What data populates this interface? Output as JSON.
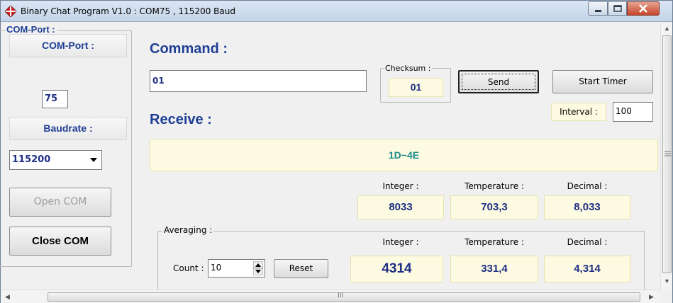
{
  "window": {
    "title": "Binary Chat Program V1.0 : COM75 , 115200 Baud"
  },
  "comport": {
    "group_title": "COM-Port :",
    "label": "COM-Port :",
    "port_value": "75",
    "baud_label": "Baudrate :",
    "baud_value": "115200",
    "open_label": "Open COM",
    "close_label": "Close COM"
  },
  "command": {
    "heading": "Command :",
    "input_value": "01",
    "checksum_title": "Checksum :",
    "checksum_value": "01",
    "send_label": "Send",
    "start_timer_label": "Start Timer",
    "interval_label": "Interval :",
    "interval_value": "100"
  },
  "receive": {
    "heading": "Receive :",
    "received_data": "1D~4E",
    "integer_label": "Integer :",
    "temperature_label": "Temperature :",
    "decimal_label": "Decimal :",
    "integer_value": "8033",
    "temperature_value": "703,3",
    "decimal_value": "8,033"
  },
  "averaging": {
    "group_title": "Averaging :",
    "count_label": "Count :",
    "count_value": "10",
    "reset_label": "Reset",
    "integer_label": "Integer :",
    "temperature_label": "Temperature :",
    "decimal_label": "Decimal :",
    "integer_value": "4314",
    "temperature_value": "331,4",
    "decimal_value": "4,314"
  },
  "scrollbar": {
    "h_grip": "III"
  },
  "icons": {
    "app": "red-cross-app-icon",
    "minimize": "minimize-icon",
    "maximize": "maximize-icon",
    "close": "close-icon",
    "dropdown": "chevron-down-icon",
    "spin": "spin-updown-icon"
  },
  "colors": {
    "accent_text": "#1f3f96",
    "value_bg": "#fcfae0",
    "received_text": "#1a8a8a",
    "close_button": "#c6462b"
  }
}
